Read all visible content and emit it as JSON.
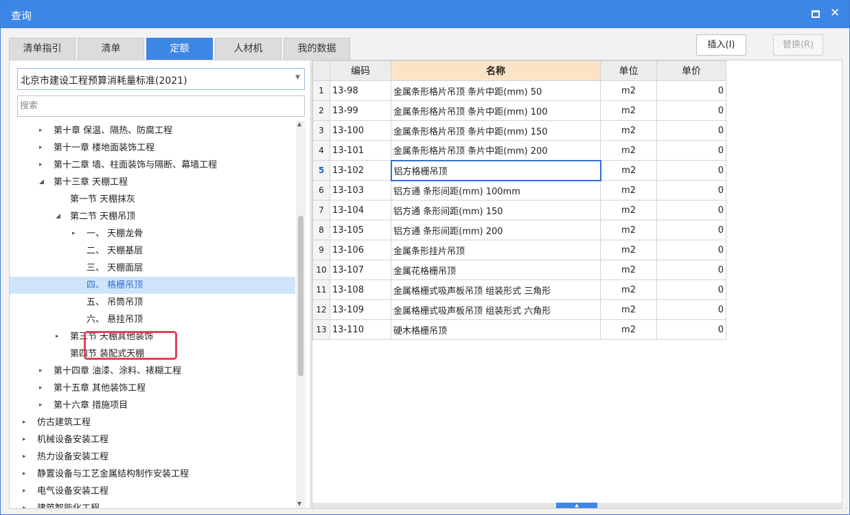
{
  "window": {
    "title": "查询"
  },
  "tabs": [
    {
      "label": "清单指引",
      "active": false
    },
    {
      "label": "清单",
      "active": false
    },
    {
      "label": "定额",
      "active": true
    },
    {
      "label": "人材机",
      "active": false
    },
    {
      "label": "我的数据",
      "active": false
    }
  ],
  "buttons": {
    "insert": "插入(I)",
    "replace": "替换(R)"
  },
  "library": {
    "selected": "北京市建设工程预算消耗量标准(2021)"
  },
  "search": {
    "placeholder": "搜索"
  },
  "tree": [
    {
      "label": "第十章 保温、隔热、防腐工程",
      "caret": "▸"
    },
    {
      "label": "第十一章 楼地面装饰工程",
      "caret": "▸"
    },
    {
      "label": "第十二章 墙、柱面装饰与隔断、幕墙工程",
      "caret": "▸"
    },
    {
      "label": "第十三章 天棚工程",
      "caret": "◢"
    },
    {
      "label": "第一节 天棚抹灰",
      "caret": ""
    },
    {
      "label": "第二节 天棚吊顶",
      "caret": "◢"
    },
    {
      "label": "一、 天棚龙骨",
      "caret": "▸"
    },
    {
      "label": "二、 天棚基层",
      "caret": ""
    },
    {
      "label": "三、 天棚面层",
      "caret": ""
    },
    {
      "label": "四、 格栅吊顶",
      "caret": "",
      "selected": true
    },
    {
      "label": "五、 吊筒吊顶",
      "caret": ""
    },
    {
      "label": "六、 悬挂吊顶",
      "caret": ""
    },
    {
      "label": "第三节 天棚其他装饰",
      "caret": "▸"
    },
    {
      "label": "第四节 装配式天棚",
      "caret": ""
    },
    {
      "label": "第十四章 油漆、涂料、裱糊工程",
      "caret": "▸"
    },
    {
      "label": "第十五章 其他装饰工程",
      "caret": "▸"
    },
    {
      "label": "第十六章 措施项目",
      "caret": "▸"
    },
    {
      "label": "仿古建筑工程",
      "caret": "▸"
    },
    {
      "label": "机械设备安装工程",
      "caret": "▸"
    },
    {
      "label": "热力设备安装工程",
      "caret": "▸"
    },
    {
      "label": "静置设备与工艺金属结构制作安装工程",
      "caret": "▸"
    },
    {
      "label": "电气设备安装工程",
      "caret": "▸"
    },
    {
      "label": "建筑智能化工程",
      "caret": "▸"
    }
  ],
  "table": {
    "headers": {
      "rownum": "",
      "code": "编码",
      "name": "名称",
      "unit": "单位",
      "price": "单价"
    },
    "rows": [
      {
        "n": "1",
        "code": "13-98",
        "name": "金属条形格片吊顶 条片中距(mm) 50",
        "unit": "m2",
        "price": "0"
      },
      {
        "n": "2",
        "code": "13-99",
        "name": "金属条形格片吊顶 条片中距(mm) 100",
        "unit": "m2",
        "price": "0"
      },
      {
        "n": "3",
        "code": "13-100",
        "name": "金属条形格片吊顶 条片中距(mm) 150",
        "unit": "m2",
        "price": "0"
      },
      {
        "n": "4",
        "code": "13-101",
        "name": "金属条形格片吊顶 条片中距(mm) 200",
        "unit": "m2",
        "price": "0"
      },
      {
        "n": "5",
        "code": "13-102",
        "name": "铝方格栅吊顶",
        "unit": "m2",
        "price": "0",
        "current": true
      },
      {
        "n": "6",
        "code": "13-103",
        "name": "铝方通 条形间距(mm) 100mm",
        "unit": "m2",
        "price": "0"
      },
      {
        "n": "7",
        "code": "13-104",
        "name": "铝方通 条形间距(mm) 150",
        "unit": "m2",
        "price": "0"
      },
      {
        "n": "8",
        "code": "13-105",
        "name": "铝方通 条形间距(mm) 200",
        "unit": "m2",
        "price": "0"
      },
      {
        "n": "9",
        "code": "13-106",
        "name": "金属条形挂片吊顶",
        "unit": "m2",
        "price": "0"
      },
      {
        "n": "10",
        "code": "13-107",
        "name": "金属花格栅吊顶",
        "unit": "m2",
        "price": "0"
      },
      {
        "n": "11",
        "code": "13-108",
        "name": "金属格栅式吸声板吊顶 组装形式 三角形",
        "unit": "m2",
        "price": "0"
      },
      {
        "n": "12",
        "code": "13-109",
        "name": "金属格栅式吸声板吊顶 组装形式 六角形",
        "unit": "m2",
        "price": "0"
      },
      {
        "n": "13",
        "code": "13-110",
        "name": "硬木格栅吊顶",
        "unit": "m2",
        "price": "0"
      }
    ]
  },
  "colors": {
    "accent": "#3c86e6",
    "highlight_border": "#e3405a",
    "name_header_bg": "#fde3c5",
    "selected_row_bg": "#cfe4fb"
  }
}
